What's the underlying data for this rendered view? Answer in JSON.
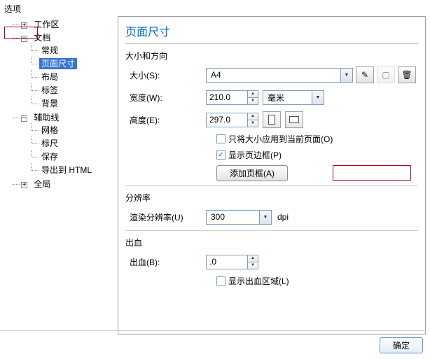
{
  "window_title": "选项",
  "tree": {
    "workspace": "工作区",
    "document": "文档",
    "doc_children": {
      "general": "常规",
      "page_size": "页面尺寸",
      "layout": "布局",
      "labels": "标签",
      "background": "背景"
    },
    "guides": "辅助线",
    "guides_children": {
      "grid": "网格",
      "rulers": "标尺",
      "save": "保存",
      "export_html": "导出到 HTML"
    },
    "global": "全局"
  },
  "content": {
    "heading": "页面尺寸",
    "size_orientation": "大小和方向",
    "size_label": "大小(S):",
    "size_value": "A4",
    "width_label": "宽度(W):",
    "width_value": "210.0",
    "width_unit": "毫米",
    "height_label": "高度(E):",
    "height_value": "297.0",
    "apply_current": "只将大小应用到当前页面(O)",
    "show_border": "显示页边框(P)",
    "add_frame": "添加页框(A)",
    "resolution_group": "分辨率",
    "render_res_label": "渲染分辨率(U)",
    "render_res_value": "300",
    "dpi": "dpi",
    "bleed_group": "出血",
    "bleed_label": "出血(B):",
    "bleed_value": ".0",
    "show_bleed": "显示出血区域(L)"
  },
  "buttons": {
    "ok": "确定"
  },
  "icons": {
    "disk": "💾",
    "page": "▭",
    "trash": "🗑"
  }
}
